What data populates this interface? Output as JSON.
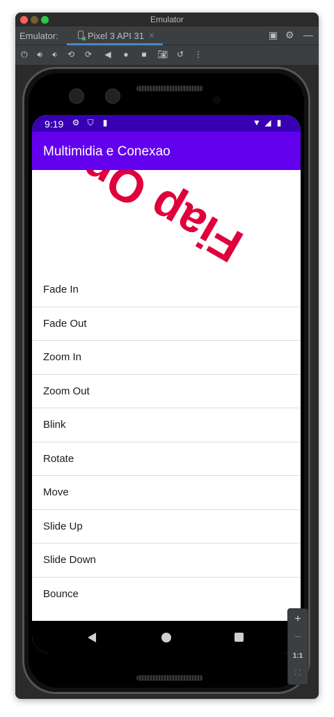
{
  "window": {
    "title": "Emulator"
  },
  "tabbar": {
    "label": "Emulator:",
    "device_tab": "Pixel 3 API 31",
    "close_glyph": "×"
  },
  "statusbar": {
    "time": "9:19"
  },
  "app": {
    "title": "Multimidia e Conexao",
    "animated_text": "Fiap On",
    "animated_color": "#e0003c",
    "primary_color": "#6200ee",
    "primary_dark": "#3700b3"
  },
  "list": {
    "items": [
      {
        "label": "Fade In"
      },
      {
        "label": "Fade Out"
      },
      {
        "label": "Zoom In"
      },
      {
        "label": "Zoom Out"
      },
      {
        "label": "Blink"
      },
      {
        "label": "Rotate"
      },
      {
        "label": "Move"
      },
      {
        "label": "Slide Up"
      },
      {
        "label": "Slide Down"
      },
      {
        "label": "Bounce"
      }
    ]
  },
  "zoom": {
    "plus": "+",
    "minus": "−",
    "one_to_one": "1:1"
  },
  "toolbar": {
    "icons": [
      "power-icon",
      "volume-up-icon",
      "volume-down-icon",
      "rotate-left-icon",
      "rotate-right-icon",
      "back-icon",
      "home-icon",
      "overview-icon",
      "screenshot-icon",
      "snapshot-icon",
      "more-icon"
    ]
  }
}
